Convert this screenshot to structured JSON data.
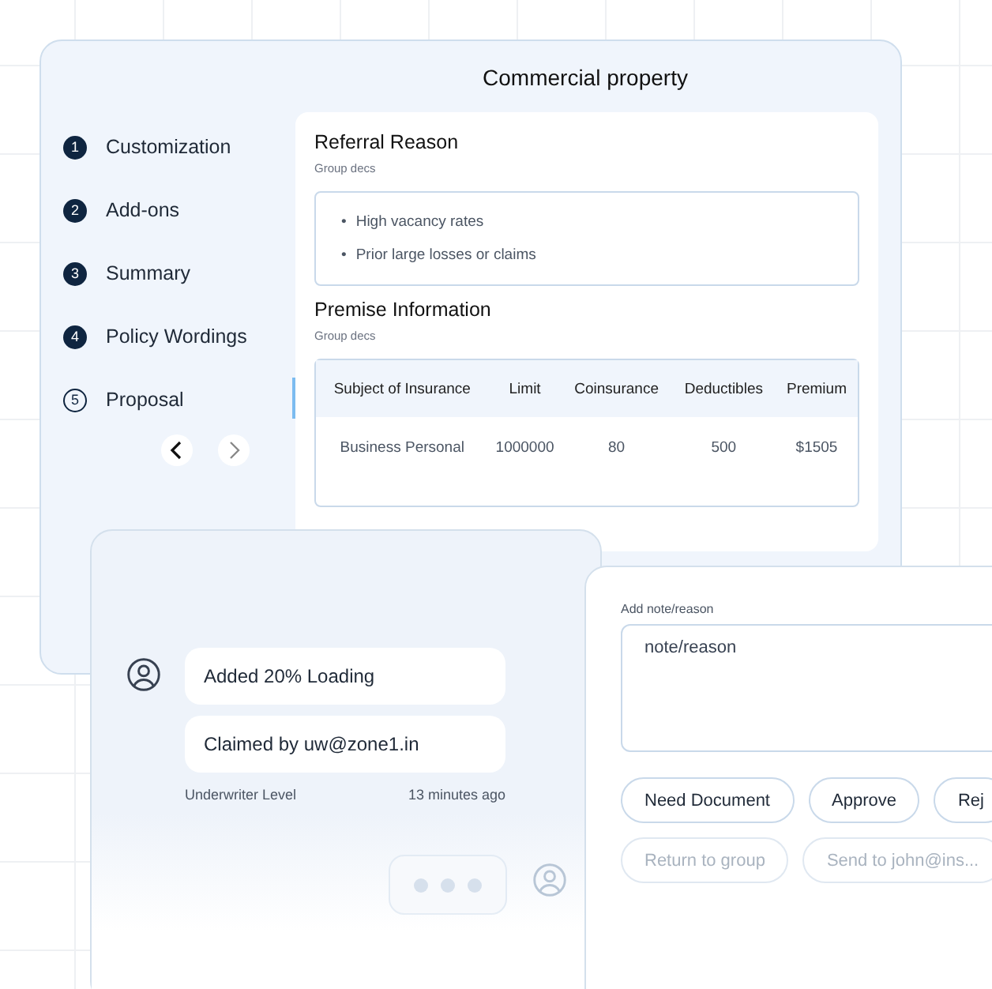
{
  "form_window": {
    "title": "Commercial property",
    "steps": [
      {
        "number": "1",
        "label": "Customization",
        "completed": true,
        "selected": false
      },
      {
        "number": "2",
        "label": "Add-ons",
        "completed": true,
        "selected": false
      },
      {
        "number": "3",
        "label": "Summary",
        "completed": true,
        "selected": false
      },
      {
        "number": "4",
        "label": "Policy Wordings",
        "completed": true,
        "selected": false
      },
      {
        "number": "5",
        "label": "Proposal",
        "completed": false,
        "selected": true
      }
    ],
    "sections": [
      {
        "kind": "list",
        "title": "Referral Reason",
        "description": "Group decs",
        "bullet": "•",
        "items": [
          "High vacancy rates",
          "Prior large losses or claims"
        ]
      },
      {
        "kind": "table",
        "title": "Premise Information",
        "description": "Group decs",
        "columns": [
          "Subject of Insurance",
          "Limit",
          "Coinsurance",
          "Deductibles",
          "Premium"
        ],
        "rows": [
          [
            "Business Personal",
            "1000000",
            "80",
            "500",
            "$1505"
          ]
        ]
      }
    ]
  },
  "activity": {
    "messages": [
      "Added 20% Loading",
      "Claimed by uw@zone1.in"
    ],
    "role": "Underwriter Level",
    "time": "13 minutes ago",
    "typing": true
  },
  "decision": {
    "label": "Add note/reason",
    "placeholder": "note/reason",
    "actions": [
      {
        "label": "Need Document",
        "disabled": false
      },
      {
        "label": "Approve",
        "disabled": false
      },
      {
        "label": "Rej",
        "disabled": false
      },
      {
        "label": "Return to group",
        "disabled": true
      },
      {
        "label": "Send to john@ins...",
        "disabled": true
      }
    ]
  }
}
